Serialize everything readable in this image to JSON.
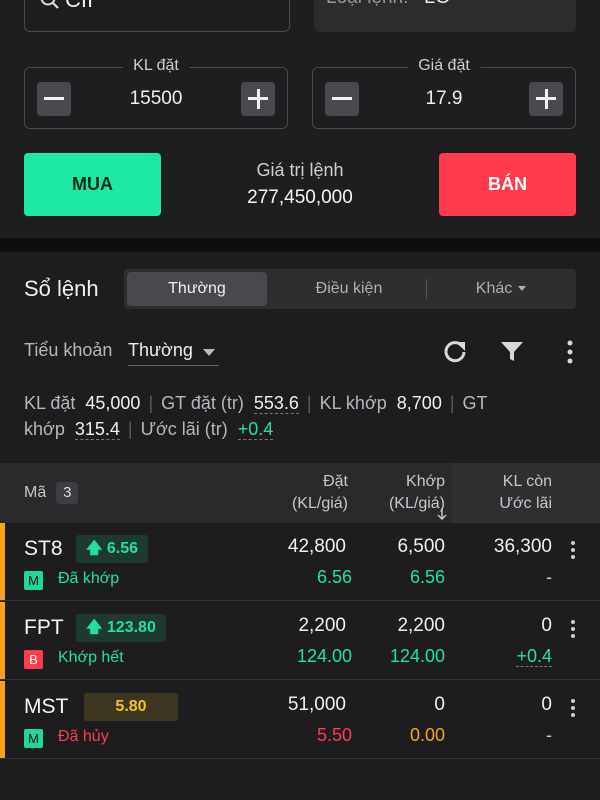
{
  "order_form": {
    "symbol": "CII",
    "order_type_label": "Loại lệnh:",
    "order_type_value": "LO",
    "quantity_label": "KL đặt",
    "quantity_value": "15500",
    "price_label": "Giá đặt",
    "price_value": "17.9",
    "buy_label": "MUA",
    "sell_label": "BÁN",
    "order_value_label": "Giá trị lệnh",
    "order_value": "277,450,000"
  },
  "order_book": {
    "title": "Sổ lệnh",
    "tabs": [
      "Thường",
      "Điều kiện",
      "Khác"
    ],
    "active_tab": "Thường",
    "subaccount_label": "Tiểu khoản",
    "subaccount_value": "Thường",
    "icons": [
      "refresh-icon",
      "filter-icon",
      "more-vertical-icon"
    ],
    "stats": {
      "kl_dat_label": "KL đặt",
      "kl_dat_value": "45,000",
      "gt_dat_label": "GT đặt (tr)",
      "gt_dat_value": "553.6",
      "kl_khop_label": "KL khớp",
      "kl_khop_value": "8,700",
      "gt_khop_label_1": "GT",
      "gt_khop_label_2": "khớp",
      "gt_khop_value": "315.4",
      "uoc_lai_label": "Ước lãi (tr)",
      "uoc_lai_value": "+0.4"
    },
    "columns": {
      "ma": "Mã",
      "count": "3",
      "dat_1": "Đặt",
      "dat_2": "(KL/giá)",
      "khop_1": "Khớp",
      "khop_2": "(KL/giá)",
      "klcon_1": "KL còn",
      "klcon_2": "Ước lãi"
    },
    "rows": [
      {
        "symbol": "ST8",
        "badge": "6.56",
        "badge_arrow": "🡅",
        "side": "M",
        "status": "Đã khớp",
        "dat_qty": "42,800",
        "dat_price": "6.56",
        "khop_qty": "6,500",
        "khop_price": "6.56",
        "remaining": "36,300",
        "pnl": "-"
      },
      {
        "symbol": "FPT",
        "badge": "123.80",
        "badge_arrow": "🡅",
        "side": "B",
        "status": "Khớp hết",
        "dat_qty": "2,200",
        "dat_price": "124.00",
        "khop_qty": "2,200",
        "khop_price": "124.00",
        "remaining": "0",
        "pnl": "+0.4"
      },
      {
        "symbol": "MST",
        "badge": "5.80",
        "side": "M",
        "status": "Đã hủy",
        "dat_qty": "51,000",
        "dat_price": "5.50",
        "khop_qty": "0",
        "khop_price": "0.00",
        "remaining": "0",
        "pnl": "-"
      }
    ]
  },
  "colors": {
    "buy": "#1ee8a6",
    "sell": "#ff3b4d",
    "up": "#21e39a",
    "reference": "#f4c325",
    "cancelled_price": "#ff3b4d",
    "zero_match": "#f6a51a",
    "row_accent": "#f7a61b"
  }
}
